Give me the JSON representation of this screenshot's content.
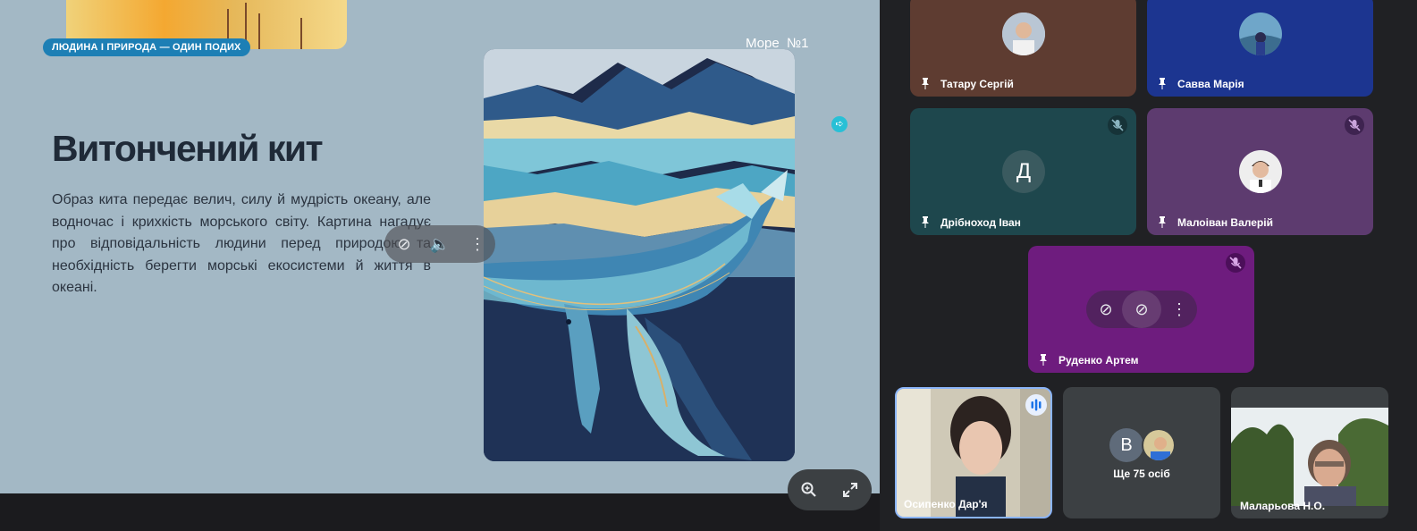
{
  "slide": {
    "badge": "ЛЮДИНА І ПРИРОДА — ОДИН ПОДИХ",
    "label": "Море  №1",
    "title": "Витончений кит",
    "text": "Образ кита передає велич, силу й мудрість океану, але водночас і крихкість морського світу. Картина нагадує про відповідальність людини перед природою та необхідність берегти морські екосистеми й життя в океані."
  },
  "participants": [
    {
      "name": "Татару Сергій",
      "tile_color": "#5e3c31"
    },
    {
      "name": "Савва Марія",
      "tile_color": "#1c3590"
    },
    {
      "name": "Дрібноход Іван",
      "initial": "Д",
      "tile_color": "#1e474d"
    },
    {
      "name": "Малоіван Валерій",
      "tile_color": "#5d3b6f"
    },
    {
      "name": "Руденко Артем",
      "tile_color": "#6e1c7e"
    }
  ],
  "self_view": {
    "name": "Осипенко Дар'я"
  },
  "others": {
    "initial": "В",
    "label": "Ще 75 осіб"
  },
  "host": {
    "name": "Маларьова Н.О."
  },
  "colors": {
    "slide_bg": "#a3b8c5",
    "badge": "#1d7fb5",
    "accent_cyan": "#28c0d6",
    "active_border": "#8ab4f8"
  }
}
